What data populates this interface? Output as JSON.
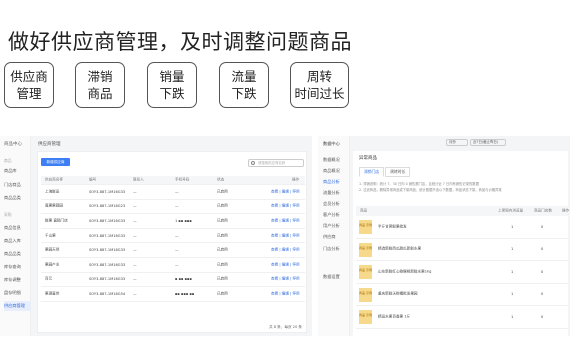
{
  "headline": "做好供应商管理，及时调整问题商品",
  "tags": [
    {
      "l1": "供应商",
      "l2": "管理"
    },
    {
      "l1": "滞销",
      "l2": "商品"
    },
    {
      "l1": "销量",
      "l2": "下跌"
    },
    {
      "l1": "流量",
      "l2": "下跌"
    },
    {
      "l1": "周转",
      "l2": "时间过长"
    }
  ],
  "left": {
    "side_header": "商品中心",
    "side_items": [
      "商品库",
      "门店商品",
      "商品品类",
      "",
      "商品信息",
      "商品入库",
      "商品品类",
      "库存查询",
      "库存调整",
      "盘存明细",
      "供应商管理"
    ],
    "side_sections": [
      "商品",
      "采购"
    ],
    "page_title": "供应商管理",
    "add_button": "新增供应商",
    "search_placeholder": "请搜索供应商名称",
    "columns": [
      "供应商名称",
      "编号",
      "联系人",
      "手机号码",
      "状态",
      "操作"
    ],
    "rows": [
      {
        "name": "上海鲜品",
        "code": "SOY3-887-1M16G33",
        "contact": "—",
        "phone": "—",
        "status": "已启用",
        "ops": "查看 | 编辑 | 停用"
      },
      {
        "name": "嘉果果蔬园",
        "code": "SOY3-887-1M16G23",
        "contact": "—",
        "phone": "—",
        "status": "已启用",
        "ops": "查看 | 编辑 | 停用"
      },
      {
        "name": "鲜果 直销门店",
        "code": "SOY3-887-1M16G33",
        "contact": "—",
        "phone": "1 ▪▪ ▪▪▪",
        "status": "已启用",
        "ops": "查看 | 编辑 | 停用"
      },
      {
        "name": "千山果",
        "code": "SOY3-887-1M16G33",
        "contact": "—",
        "phone": "—",
        "status": "已启用",
        "ops": "查看 | 编辑 | 停用"
      },
      {
        "name": "果园天然",
        "code": "SOY3-887-1M16G33",
        "contact": "—",
        "phone": "—",
        "status": "已启用",
        "ops": "查看 | 编辑 | 停用"
      },
      {
        "name": "果园产业",
        "code": "SOY3-887-1M16G33",
        "contact": "—",
        "phone": "—",
        "status": "已启用",
        "ops": "查看 | 编辑 | 停用"
      },
      {
        "name": "百元",
        "code": "SOY3-887-1M16G33",
        "contact": "—",
        "phone": "▪ ▪▪ ▪▪▪",
        "status": "已启用",
        "ops": "查看 | 编辑 | 停用"
      },
      {
        "name": "果源直供",
        "code": "SOY3-887-1M16G54",
        "contact": "—",
        "phone": "▪▪ ▪▪▪ ▪▪",
        "status": "已启用",
        "ops": "查看 | 编辑 | 停用"
      }
    ],
    "pagination": "共 8 条，每页 20 条"
  },
  "right": {
    "side_items": [
      "数据中心",
      "数据概况",
      "商品概况",
      "商品分析",
      "流量分析",
      "会员分析",
      "客户分析",
      "用户分析",
      "供应商",
      "",
      "门店分析",
      "数据设置"
    ],
    "title": "异常商品",
    "select1": "月份",
    "select2": "近7日(截止昨日)",
    "tabs": [
      "滞销门店",
      "周转时长"
    ],
    "note1": "1. 滞销说明：统计 7、30 日内 0 销售额门店，且统计近 7 日内有销售记录的数据",
    "note2": "2. 过滤商品，删除异常商品或下架商品，统计数据不含以下数据，商品状态下架，商品与价格异常",
    "columns": [
      "商品",
      "上架周内浏览量",
      "商品门店数",
      "操作"
    ],
    "rows": [
      {
        "thumb": "商品 示例",
        "name": "半斤甘蔗鲜果批发",
        "views": "1",
        "stores": "0"
      },
      {
        "thumb": "商品 示例",
        "name": "精选新鲜西瓜甜瓜新鲜水果",
        "views": "1",
        "stores": "0"
      },
      {
        "thumb": "商品 示例",
        "name": "山东新鲜红心猕猴桃新鲜水果1kg",
        "views": "1",
        "stores": "0"
      },
      {
        "thumb": "商品 示例",
        "name": "重庆新鲜沃柑橘批发果园",
        "views": "1",
        "stores": "0"
      },
      {
        "thumb": "商品 示例",
        "name": "精品水果百香果 1斤",
        "views": "1",
        "stores": "0"
      }
    ]
  }
}
